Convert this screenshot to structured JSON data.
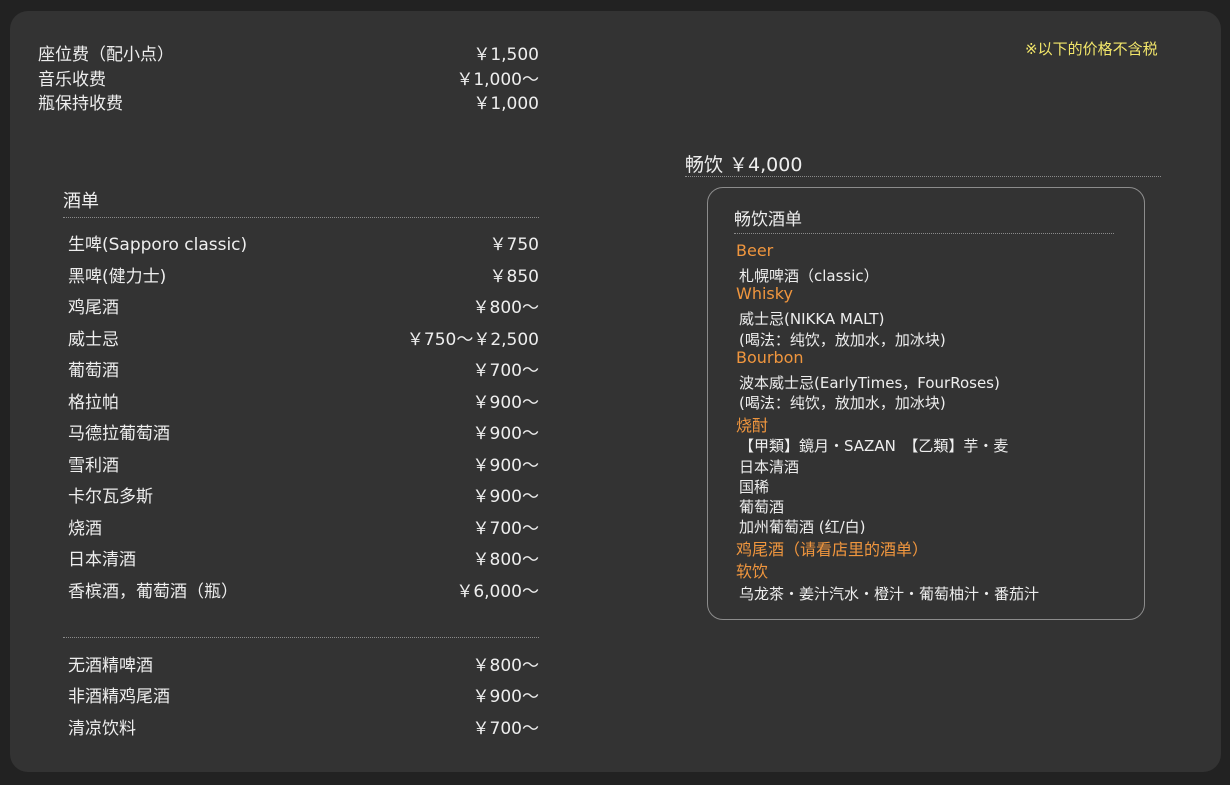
{
  "fees": [
    {
      "label": "座位费（配小点）",
      "price": "￥1,500"
    },
    {
      "label": "音乐收费",
      "price": "￥1,000～"
    },
    {
      "label": "瓶保持收费",
      "price": "￥1,000"
    }
  ],
  "tax_note": "※以下的价格不含税",
  "drinks": {
    "title": "酒单",
    "items": [
      {
        "label": "生啤(Sapporo classic)",
        "price": "￥750"
      },
      {
        "label": "黑啤(健力士)",
        "price": "￥850"
      },
      {
        "label": "鸡尾酒",
        "price": "￥800～"
      },
      {
        "label": "威士忌",
        "price": "￥750～￥2,500"
      },
      {
        "label": "葡萄酒",
        "price": "￥700～"
      },
      {
        "label": "格拉帕",
        "price": "￥900～"
      },
      {
        "label": "马德拉葡萄酒",
        "price": "￥900～"
      },
      {
        "label": "雪利酒",
        "price": "￥900～"
      },
      {
        "label": "卡尔瓦多斯",
        "price": "￥900～"
      },
      {
        "label": "烧酒",
        "price": "￥700～"
      },
      {
        "label": "日本清酒",
        "price": "￥800～"
      },
      {
        "label": "香槟酒，葡萄酒（瓶）",
        "price": "￥6,000～"
      }
    ]
  },
  "non_alcoholic": [
    {
      "label": "无酒精啤酒",
      "price": "￥800～"
    },
    {
      "label": "非酒精鸡尾酒",
      "price": "￥900～"
    },
    {
      "label": "清凉饮料",
      "price": "￥700～"
    }
  ],
  "free_flow": {
    "title": "畅饮 ￥4,000",
    "menu_title": "畅饮酒单",
    "entries": [
      {
        "kind": "cat",
        "text": "Beer"
      },
      {
        "kind": "item",
        "text": "札幌啤酒（classic）"
      },
      {
        "kind": "cat",
        "text": "Whisky"
      },
      {
        "kind": "item",
        "text": "威士忌(NIKKA MALT)"
      },
      {
        "kind": "item",
        "text": "(喝法：纯饮，放加水，加冰块)"
      },
      {
        "kind": "cat",
        "text": "Bourbon"
      },
      {
        "kind": "item",
        "text": "波本威士忌(EarlyTimes，FourRoses)"
      },
      {
        "kind": "item",
        "text": "(喝法：纯饮，放加水，加冰块)"
      },
      {
        "kind": "cat",
        "text": "烧酎"
      },
      {
        "kind": "item",
        "text": "【甲類】鏡月・SAZAN　【乙類】芋・麦"
      },
      {
        "kind": "item",
        "text": "日本清酒"
      },
      {
        "kind": "item",
        "text": "国稀"
      },
      {
        "kind": "item",
        "text": "葡萄酒"
      },
      {
        "kind": "item",
        "text": "加州葡萄酒 (红/白)"
      },
      {
        "kind": "cat",
        "text": "鸡尾酒（请看店里的酒单）"
      },
      {
        "kind": "cat",
        "text": "软饮"
      },
      {
        "kind": "item",
        "text": "乌龙茶・姜汁汽水・橙汁・葡萄柚汁・番茄汁"
      }
    ]
  },
  "colors": {
    "background": "#222222",
    "panel": "#333333",
    "category": "#f0963e",
    "note": "#f2e66a",
    "text": "#eeeeee"
  }
}
